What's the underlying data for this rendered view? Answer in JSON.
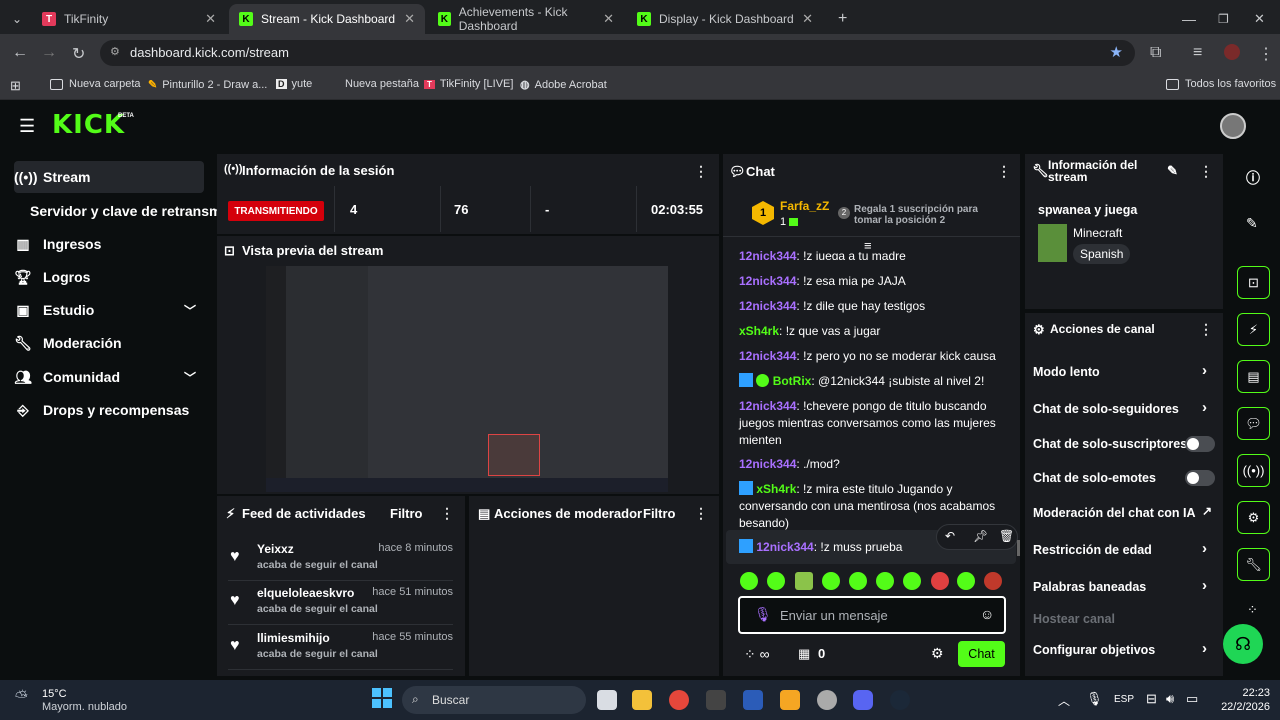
{
  "browser": {
    "tabs": [
      {
        "title": "TikFinity"
      },
      {
        "title": "Stream - Kick Dashboard"
      },
      {
        "title": "Achievements - Kick Dashboard"
      },
      {
        "title": "Display - Kick Dashboard"
      }
    ],
    "url": "dashboard.kick.com/stream",
    "bookmarks": [
      "Nueva carpeta",
      "Pinturillo 2 - Draw a...",
      "yute",
      "Nueva pestaña",
      "TikFinity [LIVE]",
      "Adobe Acrobat"
    ],
    "all_favorites": "Todos los favoritos"
  },
  "header": {
    "logo": "KICK",
    "beta": "BETA"
  },
  "sidebar": {
    "items": [
      {
        "label": "Stream",
        "icon": "broadcast-icon"
      },
      {
        "label": "Servidor y clave de retransm"
      },
      {
        "label": "Ingresos",
        "icon": "chart-icon"
      },
      {
        "label": "Logros",
        "icon": "trophy-icon"
      },
      {
        "label": "Estudio",
        "icon": "studio-icon"
      },
      {
        "label": "Moderación",
        "icon": "wrench-icon"
      },
      {
        "label": "Comunidad",
        "icon": "users-icon"
      },
      {
        "label": "Drops y recompensas",
        "icon": "gift-icon"
      }
    ]
  },
  "session": {
    "title": "Información de la sesión",
    "status": "TRANSMITIENDO",
    "viewers": "4",
    "followers": "76",
    "subs": "-",
    "duration": "02:03:55"
  },
  "preview": {
    "title": "Vista previa del stream"
  },
  "feed": {
    "title": "Feed de actividades",
    "filter": "Filtro",
    "items": [
      {
        "name": "Yeixxz",
        "time": "hace 8 minutos",
        "action": "acaba de seguir el canal"
      },
      {
        "name": "elqueloleaeskvro",
        "time": "hace 51 minutos",
        "action": "acaba de seguir el canal"
      },
      {
        "name": "llimiesmihijo",
        "time": "hace 55 minutos",
        "action": "acaba de seguir el canal"
      }
    ]
  },
  "modactions": {
    "title": "Acciones de moderador",
    "filter": "Filtro"
  },
  "chat": {
    "title": "Chat",
    "top_gifter": {
      "name": "Farfa_zZ",
      "count": "1",
      "rank": "1"
    },
    "gift_prompt": "Regala 1 suscripción para tomar la posición 2",
    "gift_rank": "2",
    "messages": [
      {
        "user": "12nick344",
        "text": "!z juega a tu madre",
        "color": "#a970ff"
      },
      {
        "user": "12nick344",
        "text": "!z esa mia pe JAJA",
        "color": "#a970ff"
      },
      {
        "user": "12nick344",
        "text": "!z dile que hay testigos",
        "color": "#a970ff"
      },
      {
        "user": "xSh4rk",
        "text": "!z que vas a jugar",
        "color": "#53fc18"
      },
      {
        "user": "12nick344",
        "text": "!z pero yo no se moderar kick causa",
        "color": "#a970ff"
      },
      {
        "user": "BotRix",
        "text": "@12nick344 ¡subiste al nivel 2!",
        "color": "#53fc18"
      },
      {
        "user": "12nick344",
        "text": "!chevere pongo de titulo buscando juegos mientras conversamos como las mujeres mienten",
        "color": "#a970ff"
      },
      {
        "user": "12nick344",
        "text": "./mod?",
        "color": "#a970ff"
      },
      {
        "user": "xSh4rk",
        "text": "!z mira este titulo Jugando y conversando con una mentirosa (nos acabamos besando)",
        "color": "#53fc18"
      },
      {
        "user": "12nick344",
        "text": "!z muss prueba",
        "color": "#a970ff"
      }
    ],
    "placeholder": "Enviar un mensaje",
    "points": "0",
    "send": "Chat"
  },
  "streaminfo": {
    "title": "Información del stream",
    "stream_title": "spwanea y juega",
    "category": "Minecraft",
    "language": "Spanish"
  },
  "channel": {
    "title": "Acciones de canal",
    "actions": [
      {
        "label": "Modo lento",
        "type": "arrow"
      },
      {
        "label": "Chat de solo-seguidores",
        "type": "arrow"
      },
      {
        "label": "Chat de solo-suscriptores",
        "type": "toggle"
      },
      {
        "label": "Chat de solo-emotes",
        "type": "toggle"
      },
      {
        "label": "Moderación del chat con IA",
        "type": "external"
      },
      {
        "label": "Restricción de edad",
        "type": "arrow"
      },
      {
        "label": "Palabras baneadas",
        "type": "arrow"
      },
      {
        "label": "Hostear canal",
        "type": "disabled"
      },
      {
        "label": "Configurar objetivos",
        "type": "arrow"
      }
    ]
  },
  "taskbar": {
    "temp": "15°C",
    "weather": "Mayorm. nublado",
    "search": "Buscar",
    "lang": "ESP",
    "time": "22:23",
    "date": "22/2/2026"
  },
  "colors": {
    "accent": "#53fc18",
    "live": "#d4000b",
    "panel": "#191b1f",
    "bg": "#0b0e0f"
  }
}
